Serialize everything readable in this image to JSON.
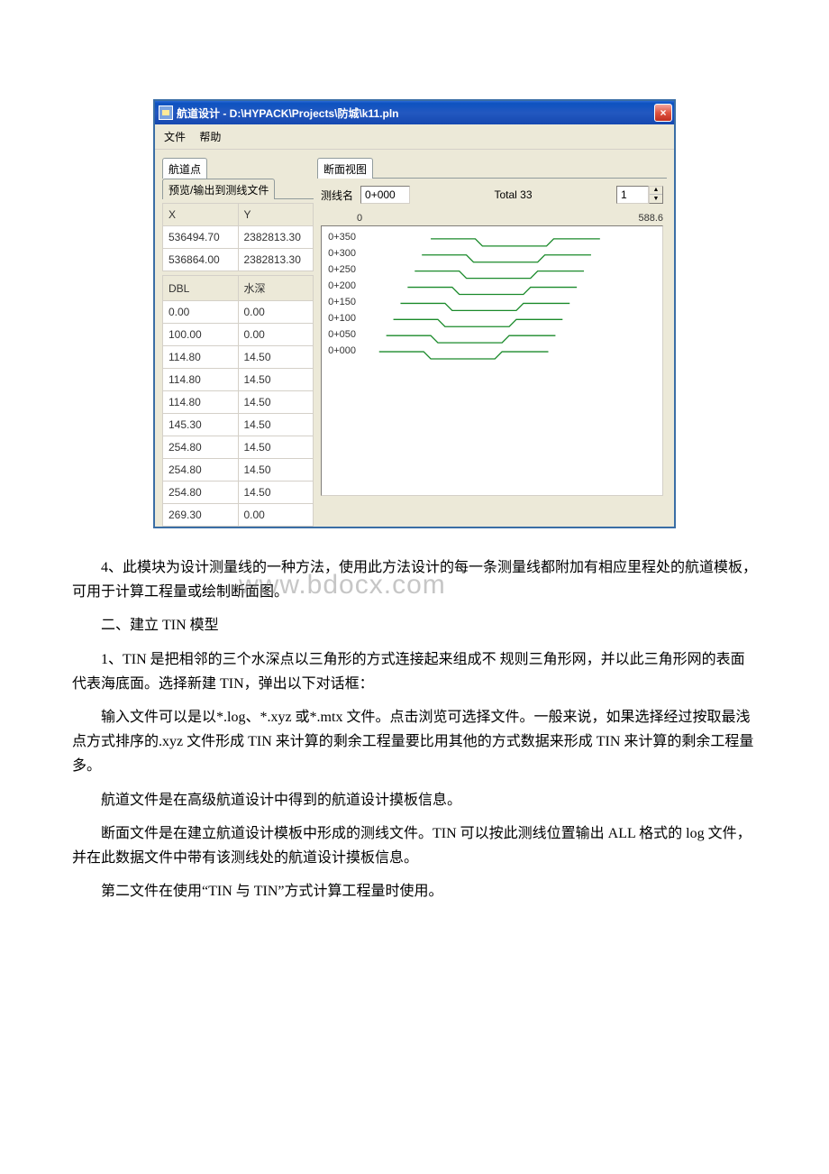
{
  "window": {
    "title": "航道设计 - D:\\HYPACK\\Projects\\防城\\k11.pln",
    "close": "×"
  },
  "menu": {
    "file": "文件",
    "help": "帮助"
  },
  "left_tabs": {
    "t1": "航道点",
    "t2": "预览/输出到测线文件"
  },
  "right_tabs": {
    "t1": "断面视图"
  },
  "xy_header": {
    "x": "X",
    "y": "Y"
  },
  "xy_rows": [
    {
      "x": "536494.70",
      "y": "2382813.30"
    },
    {
      "x": "536864.00",
      "y": "2382813.30"
    }
  ],
  "dbl_header": {
    "a": "DBL",
    "b": "水深"
  },
  "dbl_rows": [
    {
      "a": "0.00",
      "b": "0.00"
    },
    {
      "a": "100.00",
      "b": "0.00"
    },
    {
      "a": "114.80",
      "b": "14.50"
    },
    {
      "a": "114.80",
      "b": "14.50"
    },
    {
      "a": "114.80",
      "b": "14.50"
    },
    {
      "a": "145.30",
      "b": "14.50"
    },
    {
      "a": "254.80",
      "b": "14.50"
    },
    {
      "a": "254.80",
      "b": "14.50"
    },
    {
      "a": "254.80",
      "b": "14.50"
    },
    {
      "a": "269.30",
      "b": "0.00"
    }
  ],
  "right_top": {
    "line_label": "测线名",
    "line_value": "0+000",
    "total_label": "Total 33",
    "spinner_value": "1"
  },
  "scale": {
    "left": "0",
    "right": "588.6"
  },
  "y_ticks": [
    "0+350",
    "0+300",
    "0+250",
    "0+200",
    "0+150",
    "0+100",
    "0+050",
    "0+000"
  ],
  "chart_data": {
    "type": "line",
    "xlabel": "",
    "ylabel": "",
    "title": "",
    "xlim": [
      0,
      588.6
    ],
    "y_categories": [
      "0+000",
      "0+050",
      "0+100",
      "0+150",
      "0+200",
      "0+250",
      "0+300",
      "0+350"
    ],
    "series_shape_x": [
      0,
      100,
      114.8,
      254.8,
      269.3,
      369.3
    ],
    "series_shape_depth": [
      0,
      0,
      14.5,
      14.5,
      0,
      0
    ],
    "note": "Each horizontal green trace represents one survey line (y-category) using the channel template cross-section defined by series_shape_x / series_shape_depth."
  },
  "doc": {
    "p1": "4、此模块为设计测量线的一种方法，使用此方法设计的每一条测量线都附加有相应里程处的航道模板，可用于计算工程量或绘制断面图。",
    "p2": "二、建立 TIN 模型",
    "p3": "1、TIN 是把相邻的三个水深点以三角形的方式连接起来组成不 规则三角形网，并以此三角形网的表面代表海底面。选择新建 TIN，弹出以下对话框：",
    "p4": "输入文件可以是以*.log、*.xyz 或*.mtx 文件。点击浏览可选择文件。一般来说，如果选择经过按取最浅点方式排序的.xyz 文件形成 TIN 来计算的剩余工程量要比用其他的方式数据来形成 TIN 来计算的剩余工程量多。",
    "p5": "航道文件是在高级航道设计中得到的航道设计摸板信息。",
    "p6": "断面文件是在建立航道设计模板中形成的测线文件。TIN 可以按此测线位置输出 ALL 格式的 log 文件，并在此数据文件中带有该测线处的航道设计摸板信息。",
    "p7": "第二文件在使用“TIN 与 TIN”方式计算工程量时使用。"
  },
  "watermark": "www.bdocx.com"
}
